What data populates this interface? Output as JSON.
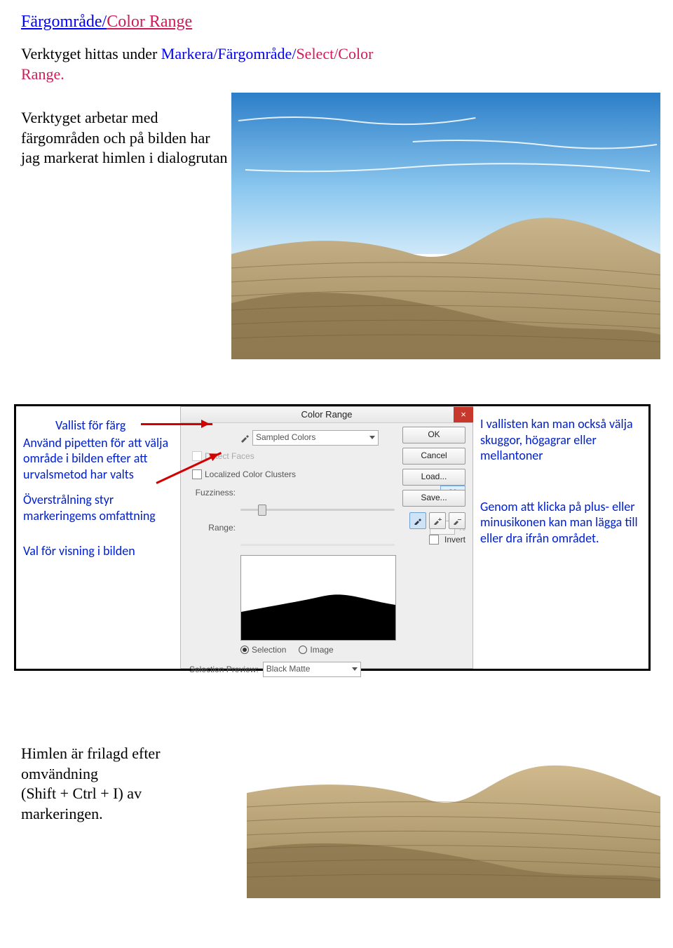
{
  "heading": {
    "sv": "Färgområde/",
    "en": "Color Range"
  },
  "intro": {
    "prefix": "Verktyget hittas under ",
    "path_sv": "Markera/Färgområde/",
    "path_en": "Select/Color Range.",
    "para": "Verktyget arbetar med färgområden och på bilden har jag markerat himlen i dialogrutan"
  },
  "annotations_left": {
    "vallist": "Vallist för färg",
    "pipetten": "Använd pipetten för att välja område i bilden efter att urvalsmetod har valts",
    "overstral": "Överstrålning styr markeringems omfattning",
    "valvisning": "Val för visning i bilden"
  },
  "annotations_right": {
    "vallisten": "I vallisten kan man också välja skuggor, högagrar eller mellantoner",
    "plusminus": "Genom att klicka på plus- eller minusikonen kan man lägga till eller dra ifrån området."
  },
  "dialog": {
    "title": "Color Range",
    "close": "×",
    "sampled": "Sampled Colors",
    "detect_faces": "Detect Faces",
    "localized": "Localized Color Clusters",
    "fuzziness_label": "Fuzziness:",
    "fuzziness_value": "30",
    "range_label": "Range:",
    "pct": "%",
    "radio_selection": "Selection",
    "radio_image": "Image",
    "selprev_label": "Selection Preview:",
    "selprev_value": "Black Matte",
    "btn_ok": "OK",
    "btn_cancel": "Cancel",
    "btn_load": "Load...",
    "btn_save": "Save...",
    "invert": "Invert"
  },
  "bottom": {
    "text1": "Himlen är frilagd efter omvändning",
    "text2": "(Shift + Ctrl + I) av markeringen."
  }
}
